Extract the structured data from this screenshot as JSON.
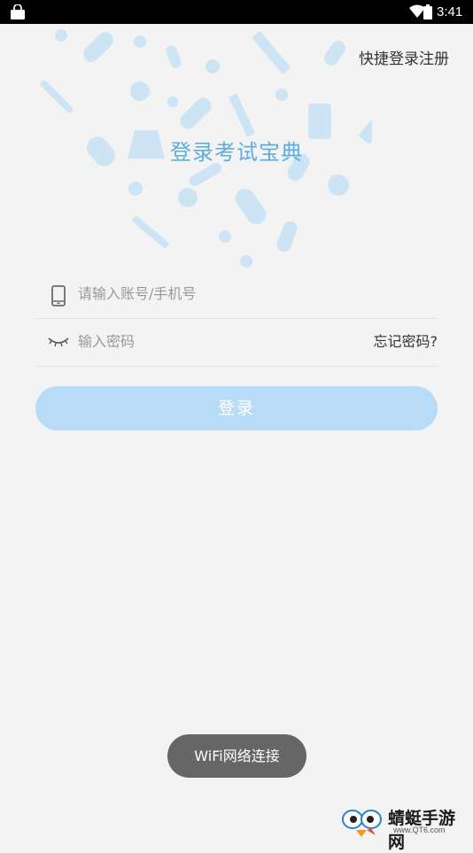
{
  "status_bar": {
    "time": "3:41"
  },
  "header": {
    "quick_login_link": "快捷登录注册"
  },
  "app_title": "登录考试宝典",
  "form": {
    "account_placeholder": "请输入账号/手机号",
    "password_placeholder": "输入密码",
    "forgot_password": "忘记密码?",
    "login_button": "登录"
  },
  "toast": "WiFi网络连接",
  "watermark": {
    "name": "蜻蜓手游网",
    "url": "www.QT6.com"
  },
  "colors": {
    "accent": "#5dade2",
    "button_bg": "#b8dcf7",
    "background": "#f3f3f3",
    "toast_bg": "#666666"
  },
  "icons": {
    "account_field": "phone-icon",
    "password_field": "closed-eye-icon",
    "background_pattern": "medical-pills-pattern"
  }
}
